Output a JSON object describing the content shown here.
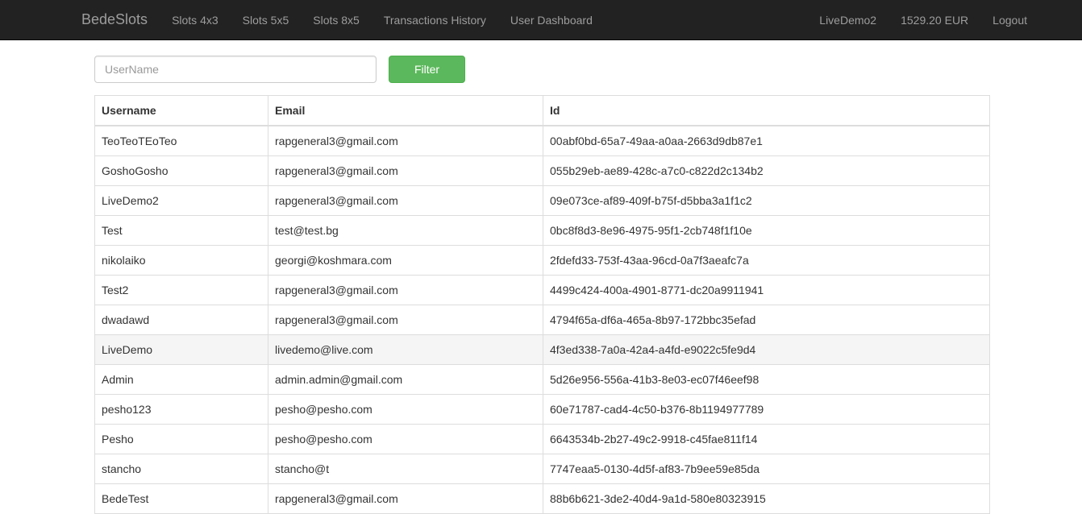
{
  "navbar": {
    "brand": "BedeSlots",
    "links": [
      "Slots 4x3",
      "Slots 5x5",
      "Slots 8x5",
      "Transactions History",
      "User Dashboard"
    ],
    "user": "LiveDemo2",
    "balance": "1529.20 EUR",
    "logout": "Logout"
  },
  "filter": {
    "placeholder": "UserName",
    "value": "",
    "button_label": "Filter"
  },
  "table": {
    "headers": {
      "username": "Username",
      "email": "Email",
      "id": "Id"
    },
    "rows": [
      {
        "username": "TeoTeoTEoTeo",
        "email": "rapgeneral3@gmail.com",
        "id": "00abf0bd-65a7-49aa-a0aa-2663d9db87e1"
      },
      {
        "username": "GoshoGosho",
        "email": "rapgeneral3@gmail.com",
        "id": "055b29eb-ae89-428c-a7c0-c822d2c134b2"
      },
      {
        "username": "LiveDemo2",
        "email": "rapgeneral3@gmail.com",
        "id": "09e073ce-af89-409f-b75f-d5bba3a1f1c2"
      },
      {
        "username": "Test",
        "email": "test@test.bg",
        "id": "0bc8f8d3-8e96-4975-95f1-2cb748f1f10e"
      },
      {
        "username": "nikolaiko",
        "email": "georgi@koshmara.com",
        "id": "2fdefd33-753f-43aa-96cd-0a7f3aeafc7a"
      },
      {
        "username": "Test2",
        "email": "rapgeneral3@gmail.com",
        "id": "4499c424-400a-4901-8771-dc20a9911941"
      },
      {
        "username": "dwadawd",
        "email": "rapgeneral3@gmail.com",
        "id": "4794f65a-df6a-465a-8b97-172bbc35efad"
      },
      {
        "username": "LiveDemo",
        "email": "livedemo@live.com",
        "id": "4f3ed338-7a0a-42a4-a4fd-e9022c5fe9d4"
      },
      {
        "username": "Admin",
        "email": "admin.admin@gmail.com",
        "id": "5d26e956-556a-41b3-8e03-ec07f46eef98"
      },
      {
        "username": "pesho123",
        "email": "pesho@pesho.com",
        "id": "60e71787-cad4-4c50-b376-8b1194977789"
      },
      {
        "username": "Pesho",
        "email": "pesho@pesho.com",
        "id": "6643534b-2b27-49c2-9918-c45fae811f14"
      },
      {
        "username": "stancho",
        "email": "stancho@t",
        "id": "7747eaa5-0130-4d5f-af83-7b9ee59e85da"
      },
      {
        "username": "BedeTest",
        "email": "rapgeneral3@gmail.com",
        "id": "88b6b621-3de2-40d4-9a1d-580e80323915"
      }
    ]
  },
  "colors": {
    "navbar_bg": "#222222",
    "nav_text": "#9d9d9d",
    "filter_button": "#5cb85c",
    "hover_row_bg": "#f5f5f5"
  }
}
